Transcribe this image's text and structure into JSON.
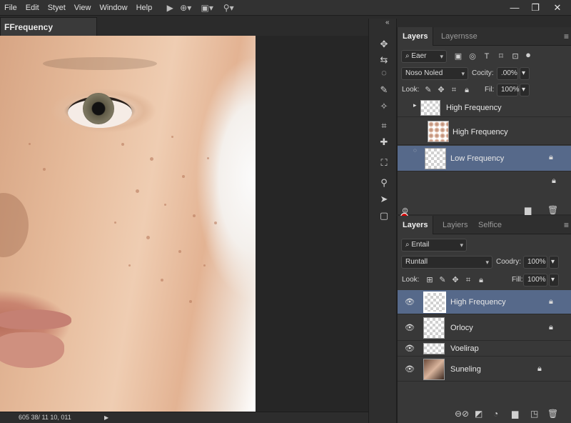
{
  "menubar": {
    "items": [
      "File",
      "Edit",
      "Styet",
      "View",
      "Window",
      "Help"
    ],
    "toolbar_icons": [
      "play-icon",
      "move-icon",
      "view-mode-icon",
      "zoom-icon"
    ],
    "window_controls": [
      "minimize",
      "restore",
      "close"
    ]
  },
  "document": {
    "tab_title": "FFrequency Separation:",
    "status_text": "605 38/ 11 10, 011"
  },
  "tools": [
    "move-tool",
    "lasso-tool",
    "quick-select-tool",
    "crop-tool",
    "eyedropper-tool",
    "healing-tool",
    "brush-tool",
    "stamp-tool",
    "eraser-tool",
    "gradient-tool",
    "pen-tool",
    "path-select-tool",
    "shape-tool"
  ],
  "panel_top": {
    "tabs": [
      "Layers",
      "Layernsse"
    ],
    "filter_label": "Eaer",
    "blend_mode": "Noso Noled",
    "opacity_label": "Cocity:",
    "opacity_value": ".00%",
    "lock_label": "Look:",
    "fill_label": "Fil:",
    "fill_value": "100%",
    "layers": [
      {
        "name": "High Frequency"
      },
      {
        "name": "High Frequency"
      },
      {
        "name": "Low Frequency"
      }
    ],
    "accent_color": "#d40000"
  },
  "panel_bottom": {
    "tabs": [
      "Layers",
      "Layiers",
      "Selfice"
    ],
    "filter_label": "Entail",
    "blend_mode": "Runtall",
    "opacity_label": "Coodry:",
    "opacity_value": "100%",
    "lock_label": "Look:",
    "fill_label": "Fill:",
    "fill_value": "100%",
    "layers": [
      {
        "name": "High Frequency"
      },
      {
        "name": "Orlocy"
      },
      {
        "name": "Voelirap"
      },
      {
        "name": "Suneling"
      }
    ],
    "selected_color": "#56698a"
  }
}
